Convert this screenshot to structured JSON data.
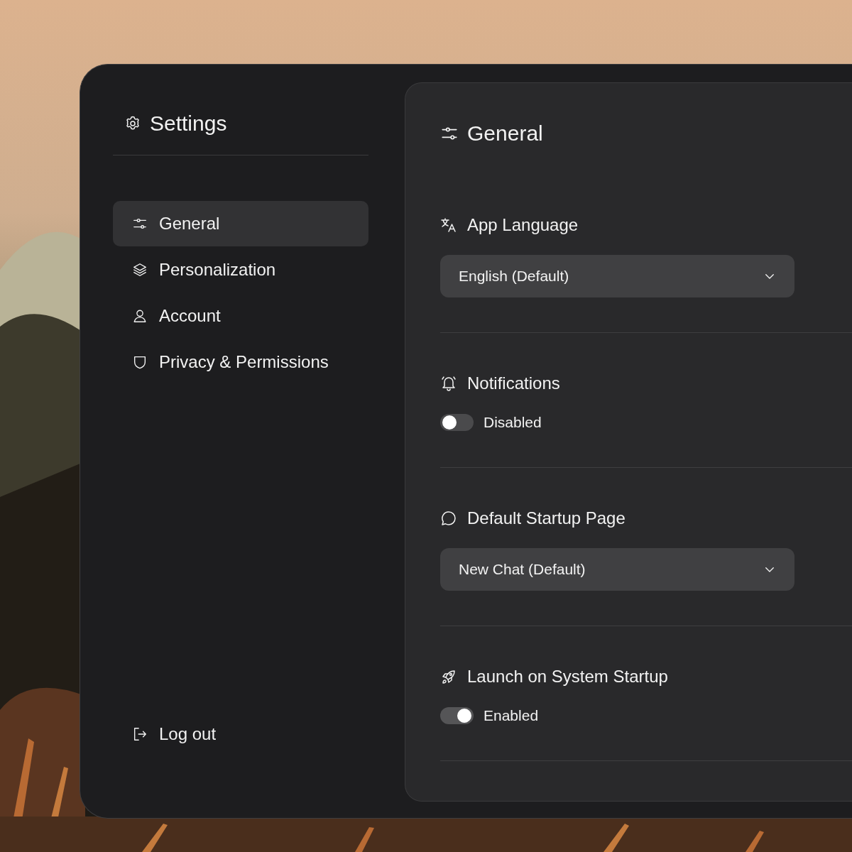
{
  "sidebar": {
    "title": "Settings",
    "items": [
      {
        "label": "General",
        "selected": true
      },
      {
        "label": "Personalization",
        "selected": false
      },
      {
        "label": "Account",
        "selected": false
      },
      {
        "label": "Privacy & Permissions",
        "selected": false
      }
    ],
    "logout": "Log out"
  },
  "panel": {
    "title": "General",
    "sections": [
      {
        "kind": "select",
        "title": "App Language",
        "value": "English (Default)"
      },
      {
        "kind": "toggle",
        "title": "Notifications",
        "on": false,
        "label": "Disabled"
      },
      {
        "kind": "select",
        "title": "Default Startup Page",
        "value": "New Chat (Default)"
      },
      {
        "kind": "toggle",
        "title": "Launch on System Startup",
        "on": true,
        "label": "Enabled"
      }
    ]
  }
}
